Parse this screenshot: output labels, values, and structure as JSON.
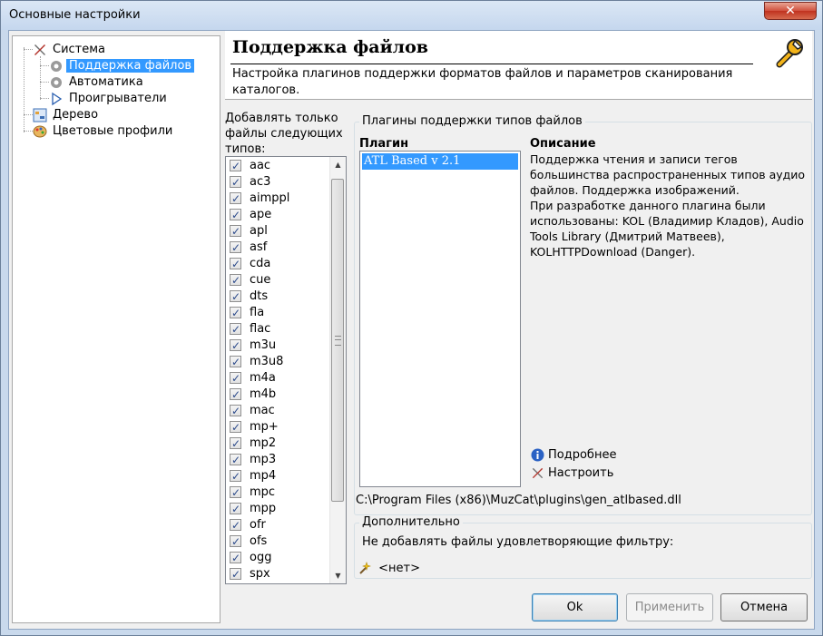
{
  "window": {
    "title": "Основные настройки",
    "close_glyph": "✕"
  },
  "tree": {
    "items": [
      {
        "label": "Система",
        "icon": "tools-icon"
      },
      {
        "label": "Поддержка файлов",
        "icon": "gear-icon"
      },
      {
        "label": "Автоматика",
        "icon": "gear-icon"
      },
      {
        "label": "Проигрыватели",
        "icon": "play-icon"
      },
      {
        "label": "Дерево",
        "icon": "tree-icon"
      },
      {
        "label": "Цветовые профили",
        "icon": "palette-icon"
      }
    ]
  },
  "header": {
    "title": "Поддержка файлов",
    "description": "Настройка плагинов поддержки форматов файлов и параметров сканирования каталогов."
  },
  "extensions": {
    "label": "Добавлять только файлы следующих типов:",
    "items": [
      "aac",
      "ac3",
      "aimppl",
      "ape",
      "apl",
      "asf",
      "cda",
      "cue",
      "dts",
      "fla",
      "flac",
      "m3u",
      "m3u8",
      "m4a",
      "m4b",
      "mac",
      "mp+",
      "mp2",
      "mp3",
      "mp4",
      "mpc",
      "mpp",
      "ofr",
      "ofs",
      "ogg",
      "spx"
    ]
  },
  "plugins": {
    "group_label": "Плагины поддержки типов файлов",
    "col_plugin": "Плагин",
    "col_description": "Описание",
    "items": [
      "ATL Based v 2.1"
    ],
    "description_lines": [
      "Поддержка чтения и записи тегов",
      "большинства распространенных типов аудио",
      "файлов. Поддержка изображений.",
      "При разработке данного плагина были",
      "использованы: KOL (Владимир Кладов),  Audio",
      "Tools Library (Дмитрий Матвеев),",
      "KOLHTTPDownload (Danger)."
    ],
    "more_label": "Подробнее",
    "configure_label": "Настроить",
    "path": "C:\\Program Files (x86)\\MuzCat\\plugins\\gen_atlbased.dll"
  },
  "extra": {
    "group_label": "Дополнительно",
    "filter_text": "Не добавлять файлы удовлетворяющие фильтру:",
    "filter_value": "<нет>"
  },
  "buttons": {
    "ok": "Ok",
    "apply": "Применить",
    "cancel": "Отмена"
  }
}
